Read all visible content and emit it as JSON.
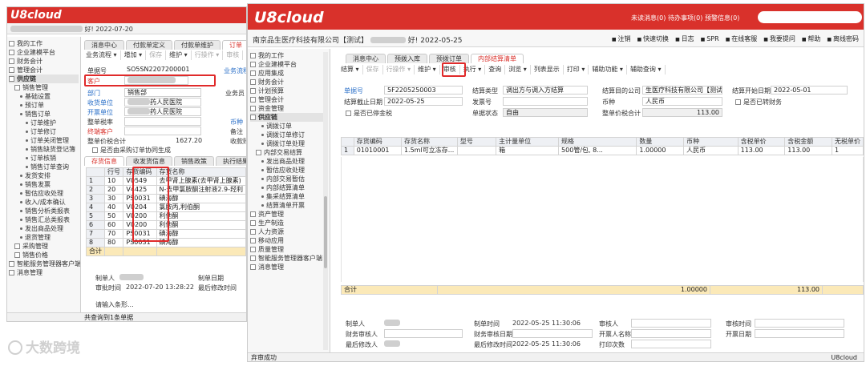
{
  "left": {
    "logo": "U8cloud",
    "date_suffix": "好! 2022-07-20",
    "tabs": [
      "消息中心",
      "付款单定义",
      "付款单维护",
      "订单"
    ],
    "toolbar": [
      "业务流程 ▾",
      "增加 ▾",
      "保存",
      "维护 ▾",
      "行操作 ▾",
      "审核",
      "执行 ▾"
    ],
    "sidebar": [
      {
        "label": "我的工作",
        "section": false,
        "indent": 0
      },
      {
        "label": "企业建模平台",
        "section": false,
        "indent": 0
      },
      {
        "label": "财务会计",
        "section": false,
        "indent": 0
      },
      {
        "label": "管理会计",
        "section": false,
        "indent": 0
      },
      {
        "label": "供应链",
        "section": true,
        "indent": 0
      },
      {
        "label": "销售管理",
        "section": false,
        "indent": 1
      },
      {
        "label": "基础设置",
        "section": false,
        "indent": 2
      },
      {
        "label": "预订单",
        "section": false,
        "indent": 2
      },
      {
        "label": "销售订单",
        "section": false,
        "indent": 2
      },
      {
        "label": "订单维护",
        "section": false,
        "indent": 3
      },
      {
        "label": "订单修订",
        "section": false,
        "indent": 3
      },
      {
        "label": "订单关闭管理",
        "section": false,
        "indent": 3
      },
      {
        "label": "销售缺货登记簿",
        "section": false,
        "indent": 3
      },
      {
        "label": "订单核销",
        "section": false,
        "indent": 3
      },
      {
        "label": "销售订单查询",
        "section": false,
        "indent": 3
      },
      {
        "label": "发货安排",
        "section": false,
        "indent": 2
      },
      {
        "label": "销售发票",
        "section": false,
        "indent": 2
      },
      {
        "label": "暂估应收处理",
        "section": false,
        "indent": 2
      },
      {
        "label": "收入/成本确认",
        "section": false,
        "indent": 2
      },
      {
        "label": "销售分析类报表",
        "section": false,
        "indent": 2
      },
      {
        "label": "销售汇总类报表",
        "section": false,
        "indent": 2
      },
      {
        "label": "发出商品处理",
        "section": false,
        "indent": 2
      },
      {
        "label": "退货管理",
        "section": false,
        "indent": 2
      },
      {
        "label": "采购管理",
        "section": false,
        "indent": 1
      },
      {
        "label": "销售价格",
        "section": false,
        "indent": 1
      },
      {
        "label": "智能服务管理器客户端",
        "section": false,
        "indent": 0
      },
      {
        "label": "消息管理",
        "section": false,
        "indent": 0
      }
    ],
    "form": {
      "order_no_label": "单据号",
      "order_no_value": "SO5SN2207200001",
      "flow_label": "业务流程",
      "customer_label": "客户",
      "dept_label": "部门",
      "dept_value": "销售部",
      "salesman_label": "业务员",
      "receiver_label": "收货单位",
      "receiver_value": "药人民医院",
      "invoice_label": "开票单位",
      "invoice_value": "药人民医院",
      "tax_label": "整单税率",
      "currency_label": "币种",
      "settle_label": "终端客户",
      "note_label": "备注",
      "total_label": "整单价税合计",
      "total_value": "1627.20",
      "account_label": "收款账户",
      "checkbox_label": "是否由采购订单协同生成"
    },
    "subtabs": [
      "存货信息",
      "收发货信息",
      "销售政策",
      "执行结果"
    ],
    "grid": {
      "headers": [
        "",
        "行号",
        "存货编码",
        "存货名称"
      ],
      "rows": [
        [
          "1",
          "10",
          "V0549",
          "去甲肾上腺素(去甲肾上腺素)"
        ],
        [
          "2",
          "20",
          "V4425",
          "N-去甲氯胺酮注射液2.9-羟利"
        ],
        [
          "3",
          "30",
          "PS0031",
          "碘海醇"
        ],
        [
          "4",
          "40",
          "V0204",
          "氯胺丙,利伯酮"
        ],
        [
          "5",
          "50",
          "V0200",
          "利他酮"
        ],
        [
          "6",
          "60",
          "V0200",
          "利他酮"
        ],
        [
          "7",
          "70",
          "PS0031",
          "碘海醇"
        ],
        [
          "8",
          "80",
          "PS0031",
          "碘海醇"
        ]
      ],
      "sum_label": "合计"
    },
    "footer": {
      "maker_label": "制单人",
      "make_date_label": "制单日期",
      "audit_time_label": "审批时间",
      "audit_time_value": "2022-07-20 13:28:22",
      "modify_label": "最后修改时间",
      "modify_value": "2022-07-20 13:28:22",
      "more_label": "请输入条形...",
      "status": "共查询到1条单据"
    }
  },
  "right": {
    "logo": "U8cloud",
    "header_links": [
      "未读消息(0)",
      "待办事项(0)",
      "预警信息(0)"
    ],
    "company": "南京品生医疗科技有限公司【测试】",
    "greeting": "好! 2022-05-25",
    "sub_links": [
      "注销",
      "快速切换",
      "日志",
      "SPR",
      "在线客服",
      "我要提问",
      "帮助",
      "离线密码"
    ],
    "tabs": [
      "消息中心",
      "预拨入库",
      "预拨订单",
      "内部结算清单"
    ],
    "toolbar": [
      "结算 ▾",
      "保存",
      "行操作 ▾",
      "维护 ▾",
      "审核",
      "执行 ▾",
      "查询",
      "浏览 ▾",
      "列表显示",
      "打印 ▾",
      "辅助功能 ▾",
      "辅助查询 ▾"
    ],
    "sidebar": [
      {
        "label": "我的工作",
        "section": false,
        "indent": 0
      },
      {
        "label": "企业建模平台",
        "section": false,
        "indent": 0
      },
      {
        "label": "应用集成",
        "section": false,
        "indent": 0
      },
      {
        "label": "财务会计",
        "section": false,
        "indent": 0
      },
      {
        "label": "计划预算",
        "section": false,
        "indent": 0
      },
      {
        "label": "管理会计",
        "section": false,
        "indent": 0
      },
      {
        "label": "资金管理",
        "section": false,
        "indent": 0
      },
      {
        "label": "供应链",
        "section": true,
        "indent": 0
      },
      {
        "label": "调拨订单",
        "section": false,
        "indent": 2
      },
      {
        "label": "调拨订单修订",
        "section": false,
        "indent": 2
      },
      {
        "label": "调拨订单处理",
        "section": false,
        "indent": 2
      },
      {
        "label": "内部交易结算",
        "section": false,
        "indent": 1
      },
      {
        "label": "发出商品处理",
        "section": false,
        "indent": 2
      },
      {
        "label": "暂估应收处理",
        "section": false,
        "indent": 2
      },
      {
        "label": "内部交易暂估",
        "section": false,
        "indent": 2
      },
      {
        "label": "内部结算清单",
        "section": false,
        "indent": 2
      },
      {
        "label": "集采结算清单",
        "section": false,
        "indent": 2
      },
      {
        "label": "结算清单开票",
        "section": false,
        "indent": 2
      },
      {
        "label": "资产管理",
        "section": false,
        "indent": 0
      },
      {
        "label": "生产制造",
        "section": false,
        "indent": 0
      },
      {
        "label": "人力资源",
        "section": false,
        "indent": 0
      },
      {
        "label": "移动应用",
        "section": false,
        "indent": 0
      },
      {
        "label": "质量管理",
        "section": false,
        "indent": 0
      },
      {
        "label": "智能服务管理器客户端",
        "section": false,
        "indent": 0
      },
      {
        "label": "消息管理",
        "section": false,
        "indent": 0
      }
    ],
    "form": {
      "doc_no_label": "单据号",
      "doc_no_value": "5F2205250003",
      "settle_type_label": "结算类型",
      "settle_type_value": "调出方与调入方结算",
      "target_label": "结算目的公司",
      "target_value": "生医疗科技有限公司【测试】",
      "start_label": "结算开始日期",
      "start_value": "2022-05-01",
      "end_label": "结算截止日期",
      "end_value": "2022-05-25",
      "invoice_no_label": "发票号",
      "currency_label": "币种",
      "currency_value": "人民币",
      "finance_label": "是否已转财务",
      "stop_label": "是否已停金税",
      "status_label": "单据状态",
      "status_value": "自由",
      "total_label": "整单价税合计",
      "total_value": "113.00"
    },
    "grid": {
      "headers": [
        "",
        "存货编码",
        "存货名称",
        "型号",
        "主计量单位",
        "规格",
        "数量",
        "币种",
        "含税单价",
        "含税金额",
        "无税单价"
      ],
      "rows": [
        [
          "1",
          "01010001",
          "1.5ml可立冻存...",
          "",
          "箱",
          "500管/包, 8...",
          "1.00000",
          "人民币",
          "113.00",
          "113.00",
          "1"
        ]
      ],
      "sum_label": "合计",
      "sum_qty": "1.00000",
      "sum_amount": "113.00"
    },
    "footer": {
      "maker_label": "制单人",
      "make_time_label": "制单时间",
      "make_time_value": "2022-05-25 11:30:06",
      "auditor_label": "审核人",
      "audit_time_label": "审核时间",
      "fin_auditor_label": "财务审核人",
      "fin_audit_date_label": "财务审核日期",
      "invoicer_label": "开票人名称",
      "invoice_date_label": "开票日期",
      "last_modifier_label": "最后修改人",
      "last_modify_time_label": "最后修改时间",
      "last_modify_time_value": "2022-05-25 11:30:06",
      "print_count_label": "打印次数",
      "status": "弃审成功",
      "brand": "U8cloud"
    }
  },
  "watermark": "大数跨境",
  "colors": {
    "brand_red": "#d9312b",
    "highlight_box": "#e02a2a",
    "sum_row": "#fbe9b8",
    "link_blue": "#2a6fc8"
  }
}
